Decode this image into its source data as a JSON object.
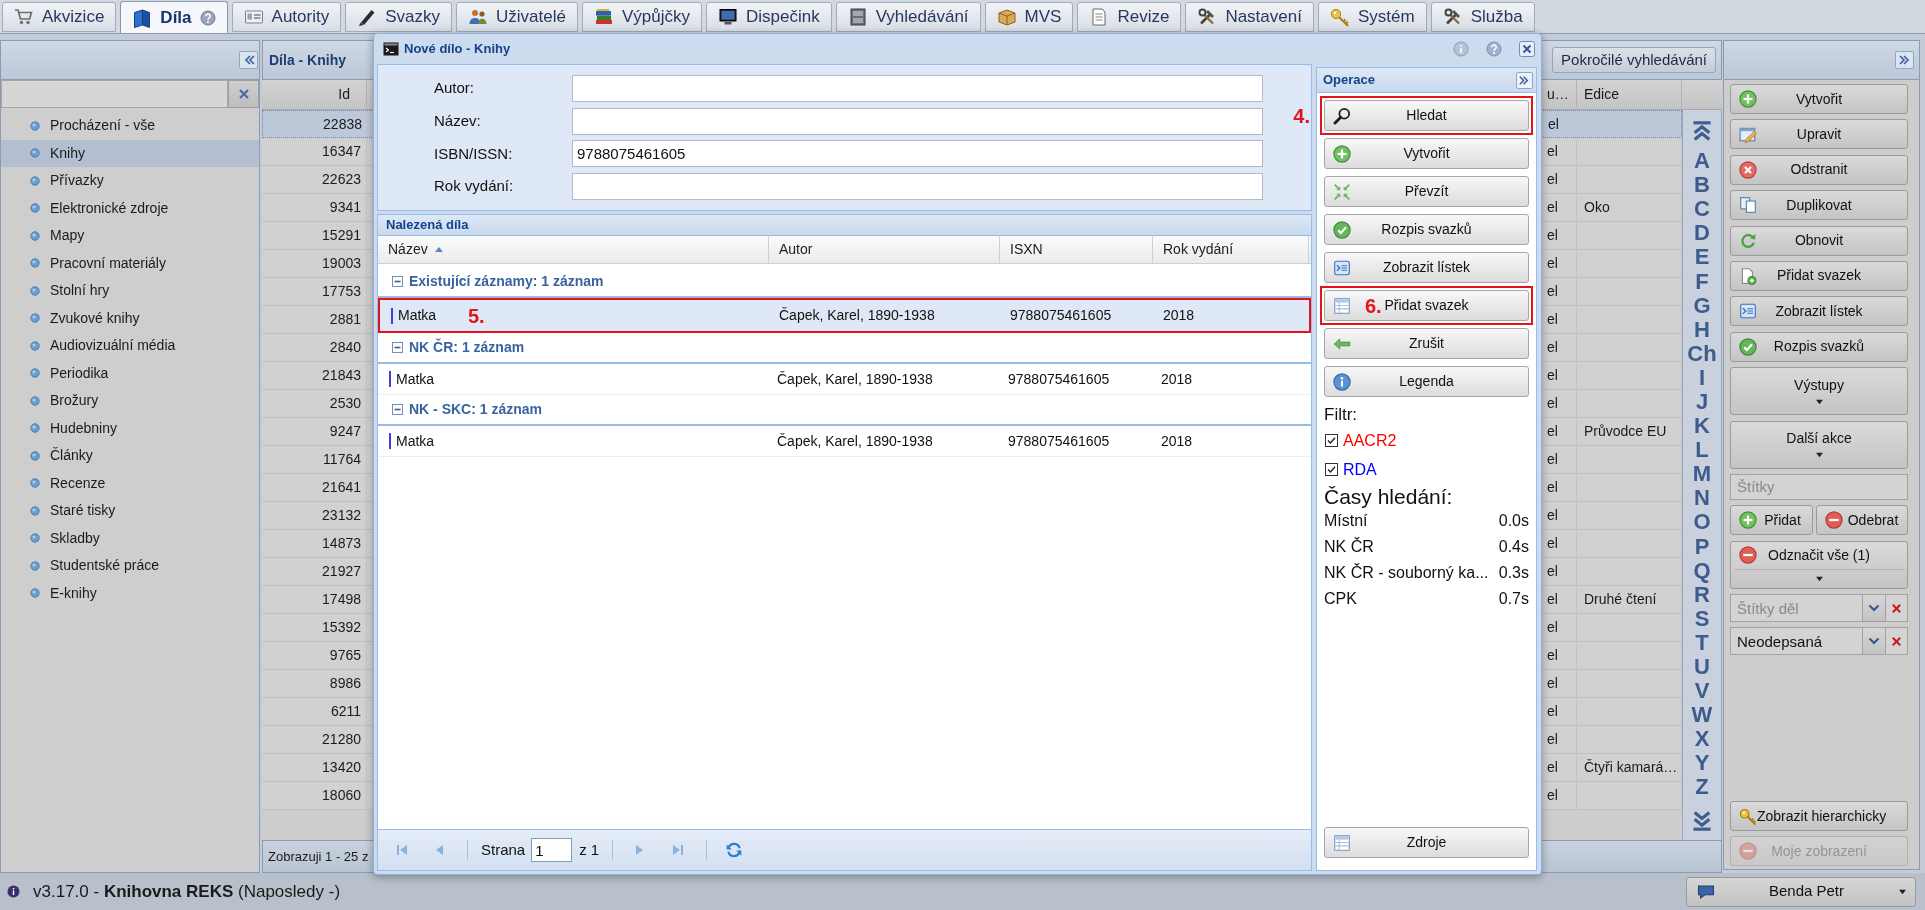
{
  "tabs": [
    {
      "label": "Akvizice",
      "kind": "acquisition",
      "selected": false,
      "help": false
    },
    {
      "label": "Díla",
      "kind": "works",
      "selected": true,
      "help": true
    },
    {
      "label": "Autority",
      "kind": "authorities",
      "selected": false,
      "help": false
    },
    {
      "label": "Svazky",
      "kind": "volumes",
      "selected": false,
      "help": false
    },
    {
      "label": "Uživatelé",
      "kind": "users",
      "selected": false,
      "help": false
    },
    {
      "label": "Výpůjčky",
      "kind": "loans",
      "selected": false,
      "help": false
    },
    {
      "label": "Dispečink",
      "kind": "dispatch",
      "selected": false,
      "help": false
    },
    {
      "label": "Vyhledávání",
      "kind": "search",
      "selected": false,
      "help": false
    },
    {
      "label": "MVS",
      "kind": "ill",
      "selected": false,
      "help": false
    },
    {
      "label": "Revize",
      "kind": "revision",
      "selected": false,
      "help": false
    },
    {
      "label": "Nastavení",
      "kind": "settings",
      "selected": false,
      "help": false
    },
    {
      "label": "Systém",
      "kind": "system",
      "selected": false,
      "help": false
    },
    {
      "label": "Služba",
      "kind": "service",
      "selected": false,
      "help": false
    }
  ],
  "sidebar": {
    "items": [
      {
        "label": "Procházení - vše",
        "selected": false
      },
      {
        "label": "Knihy",
        "selected": true
      },
      {
        "label": "Přívazky",
        "selected": false
      },
      {
        "label": "Elektronické zdroje",
        "selected": false
      },
      {
        "label": "Mapy",
        "selected": false
      },
      {
        "label": "Pracovní materiály",
        "selected": false
      },
      {
        "label": "Stolní hry",
        "selected": false
      },
      {
        "label": "Zvukové knihy",
        "selected": false
      },
      {
        "label": "Audiovizuální média",
        "selected": false
      },
      {
        "label": "Periodika",
        "selected": false
      },
      {
        "label": "Brožury",
        "selected": false
      },
      {
        "label": "Hudebniny",
        "selected": false
      },
      {
        "label": "Články",
        "selected": false
      },
      {
        "label": "Recenze",
        "selected": false
      },
      {
        "label": "Staré tisky",
        "selected": false
      },
      {
        "label": "Skladby",
        "selected": false
      },
      {
        "label": "Studentské práce",
        "selected": false
      },
      {
        "label": "E-knihy",
        "selected": false
      }
    ]
  },
  "grid": {
    "title": "Díla - Knihy",
    "advanced_search": "Pokročilé vyhledávání",
    "columns": {
      "id": "Id",
      "column_2": "u…",
      "edice": "Edice"
    },
    "rows": [
      {
        "id": "22838",
        "column_2": "el",
        "selected": true
      },
      {
        "id": "16347",
        "column_2": "el",
        "selected": false
      },
      {
        "id": "22623",
        "column_2": "el",
        "selected": false
      },
      {
        "id": "9341",
        "column_2": "el",
        "edice": "Oko",
        "selected": false
      },
      {
        "id": "15291",
        "column_2": "el",
        "selected": false
      },
      {
        "id": "19003",
        "column_2": "el",
        "selected": false
      },
      {
        "id": "17753",
        "column_2": "el",
        "selected": false
      },
      {
        "id": "2881",
        "column_2": "el",
        "selected": false
      },
      {
        "id": "2840",
        "column_2": "el",
        "selected": false
      },
      {
        "id": "21843",
        "column_2": "el",
        "selected": false
      },
      {
        "id": "2530",
        "column_2": "el",
        "selected": false
      },
      {
        "id": "9247",
        "column_2": "el",
        "edice": "Průvodce EU",
        "selected": false
      },
      {
        "id": "11764",
        "column_2": "el",
        "selected": false
      },
      {
        "id": "21641",
        "column_2": "el",
        "selected": false
      },
      {
        "id": "23132",
        "column_2": "el",
        "selected": false
      },
      {
        "id": "14873",
        "column_2": "el",
        "selected": false
      },
      {
        "id": "21927",
        "column_2": "el",
        "selected": false
      },
      {
        "id": "17498",
        "column_2": "el",
        "edice": "Druhé čtení",
        "selected": false
      },
      {
        "id": "15392",
        "column_2": "el",
        "selected": false
      },
      {
        "id": "9765",
        "column_2": "el",
        "selected": false
      },
      {
        "id": "8986",
        "column_2": "el",
        "selected": false
      },
      {
        "id": "6211",
        "column_2": "el",
        "selected": false
      },
      {
        "id": "21280",
        "column_2": "el",
        "selected": false
      },
      {
        "id": "13420",
        "column_2": "el",
        "edice": "Čtyři kamará…",
        "selected": false
      },
      {
        "id": "18060",
        "column_2": "el",
        "selected": false
      }
    ],
    "footer": "Zobrazuji 1 - 25 z",
    "alphabet": [
      "A",
      "B",
      "C",
      "D",
      "E",
      "F",
      "G",
      "H",
      "Ch",
      "I",
      "J",
      "K",
      "L",
      "M",
      "N",
      "O",
      "P",
      "Q",
      "R",
      "S",
      "T",
      "U",
      "V",
      "W",
      "X",
      "Y",
      "Z"
    ]
  },
  "dialog": {
    "title": "Nové dílo - Knihy",
    "form": [
      {
        "label": "Autor:"
      },
      {
        "label": "Název:"
      },
      {
        "label": "ISBN/ISSN:",
        "value": "9788075461605"
      },
      {
        "label": "Rok vydání:"
      }
    ],
    "results": {
      "title": "Nalezená díla",
      "columns": [
        {
          "label": "Název",
          "sorted": true
        },
        {
          "label": "Autor",
          "sorted": false
        },
        {
          "label": "ISXN",
          "sorted": false
        },
        {
          "label": "Rok vydání",
          "sorted": false
        }
      ],
      "groups": [
        {
          "title": "Existující záznamy: 1 záznam",
          "expanded": true,
          "rows": [
            {
              "title": "Matka",
              "author": "Čapek, Karel, 1890-1938",
              "isxn": "9788075461605",
              "year": "2018",
              "color": "#3d3de0",
              "selected": true,
              "callout": {
                "label": "5.",
                "outside": false
              }
            }
          ]
        },
        {
          "title": "NK ČR: 1 záznam",
          "expanded": true,
          "rows": [
            {
              "title": "Matka",
              "author": "Čapek, Karel, 1890-1938",
              "isxn": "9788075461605",
              "year": "2018",
              "color": "#3d3de0",
              "selected": false
            }
          ]
        },
        {
          "title": "NK - SKC: 1 záznam",
          "expanded": true,
          "rows": [
            {
              "title": "Matka",
              "author": "Čapek, Karel, 1890-1938",
              "isxn": "9788075461605",
              "year": "2018",
              "color": "#3d3de0",
              "selected": false
            }
          ]
        }
      ]
    },
    "pager": {
      "label": "Strana",
      "page": "1",
      "total": "z 1"
    },
    "operations": {
      "title": "Operace",
      "buttons": [
        {
          "kind": "search",
          "label": "Hledat",
          "callout": {
            "label": "4.",
            "outside": true
          }
        },
        {
          "kind": "create",
          "label": "Vytvořit"
        },
        {
          "kind": "import",
          "label": "Převzít"
        },
        {
          "kind": "volumes",
          "label": "Rozpis svazků"
        },
        {
          "kind": "card",
          "label": "Zobrazit lístek"
        },
        {
          "kind": "attach",
          "label": "Přidat svazek",
          "callout": {
            "label": "6.",
            "outside": false
          }
        },
        {
          "kind": "back",
          "label": "Zrušit"
        },
        {
          "kind": "info",
          "label": "Legenda"
        }
      ],
      "filter": {
        "title": "Filtr:",
        "options": [
          {
            "label": "AACR2",
            "checked": true,
            "color": "#ff0000"
          },
          {
            "label": "RDA",
            "checked": true,
            "color": "#0000ff"
          }
        ]
      },
      "times": {
        "title": "Časy hledání:",
        "rows": [
          {
            "source": "Místní",
            "time": "0.0s"
          },
          {
            "source": "NK ČR",
            "time": "0.4s"
          },
          {
            "source": "NK ČR - souborný ka...",
            "time": "0.3s"
          },
          {
            "source": "CPK",
            "time": "0.7s"
          }
        ]
      },
      "footer_button": {
        "kind": "sources",
        "label": "Zdroje"
      }
    }
  },
  "actions_panel": {
    "buttons": [
      {
        "kind": "create",
        "label": "Vytvořit"
      },
      {
        "kind": "edit",
        "label": "Upravit"
      },
      {
        "kind": "delete",
        "label": "Odstranit"
      },
      {
        "kind": "duplicate",
        "label": "Duplikovat"
      },
      {
        "kind": "refresh",
        "label": "Obnovit"
      },
      {
        "kind": "append",
        "label": "Přidat svazek"
      },
      {
        "kind": "card",
        "label": "Zobrazit lístek"
      },
      {
        "kind": "volumes",
        "label": "Rozpis svazků"
      }
    ],
    "menus": [
      {
        "label": "Výstupy"
      },
      {
        "label": "Další akce"
      }
    ],
    "tags_field": {
      "placeholder": "Štítky"
    },
    "tag_buttons": [
      {
        "kind": "add",
        "label": "Přidat"
      },
      {
        "kind": "remove",
        "label": "Odebrat"
      }
    ],
    "unmark_menu": {
      "kind": "unmark",
      "label": "Odznačit vše (1)"
    },
    "filters": [
      {
        "placeholder": "Štítky děl"
      },
      {
        "value": "Neodepsaná"
      }
    ],
    "bottom_buttons": [
      {
        "kind": "hierarchy",
        "label": "Zobrazit hierarchicky",
        "disabled": false
      },
      {
        "kind": "view",
        "label": "Moje zobrazení",
        "disabled": true
      }
    ]
  },
  "status_bar": {
    "text": "v3.17.0 - **Knihovna REKS** (Naposledy -)",
    "user": "Benda Petr"
  }
}
